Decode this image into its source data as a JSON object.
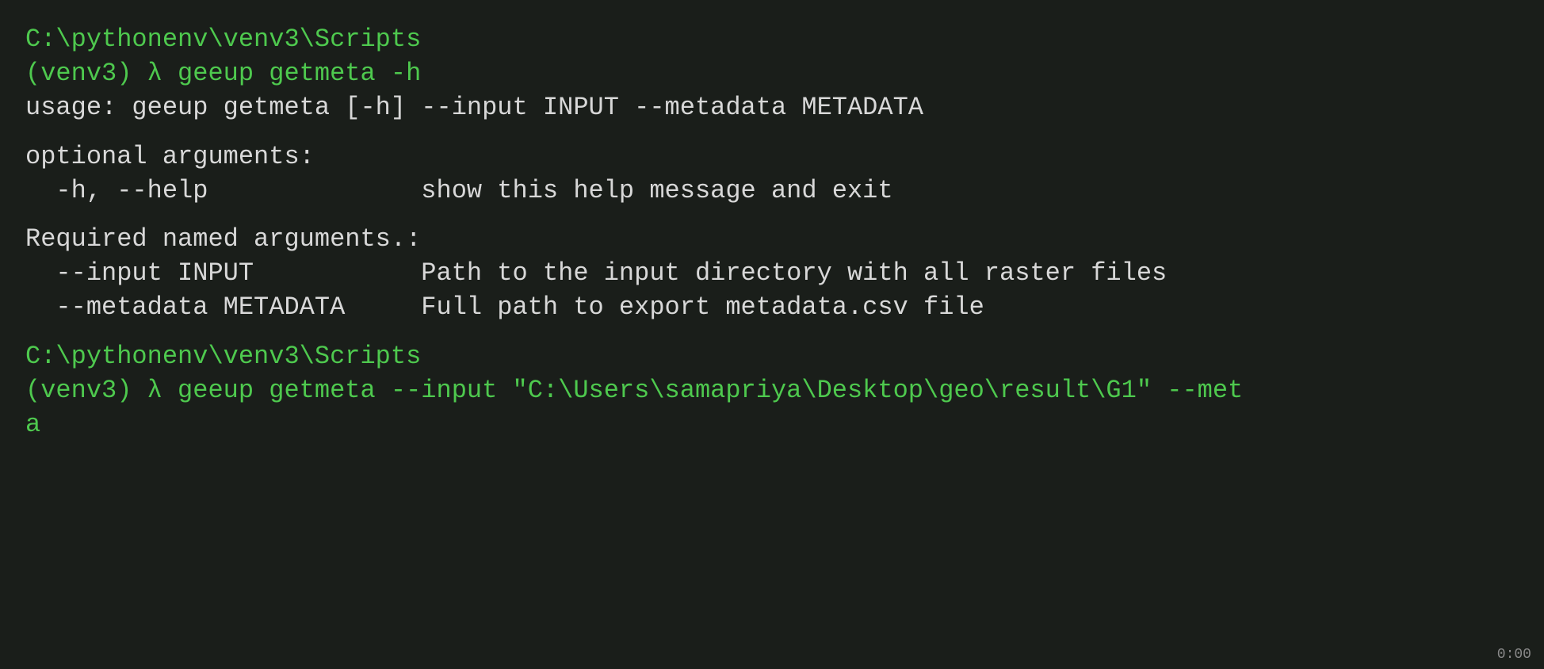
{
  "terminal": {
    "background": "#1a1e1a",
    "lines": [
      {
        "id": "path1",
        "text": "C:\\pythonenv\\venv3\\Scripts",
        "color": "green"
      },
      {
        "id": "prompt1",
        "text": "(venv3) λ geeup getmeta -h",
        "color": "green"
      },
      {
        "id": "usage",
        "text": "usage: geeup getmeta [-h] --input INPUT --metadata METADATA",
        "color": "white"
      },
      {
        "id": "spacer1",
        "text": "",
        "color": "white"
      },
      {
        "id": "optional",
        "text": "optional arguments:",
        "color": "white"
      },
      {
        "id": "help_flag",
        "text": "  -h, --help              show this help message and exit",
        "color": "white"
      },
      {
        "id": "spacer2",
        "text": "",
        "color": "white"
      },
      {
        "id": "required",
        "text": "Required named arguments.:",
        "color": "white"
      },
      {
        "id": "input_arg",
        "text": "  --input INPUT           Path to the input directory with all raster files",
        "color": "white"
      },
      {
        "id": "metadata_arg",
        "text": "  --metadata METADATA     Full path to export metadata.csv file",
        "color": "white"
      },
      {
        "id": "spacer3",
        "text": "",
        "color": "white"
      },
      {
        "id": "path2",
        "text": "C:\\pythonenv\\venv3\\Scripts",
        "color": "green"
      },
      {
        "id": "prompt2_line1",
        "text": "(venv3) λ geeup getmeta --input \"C:\\Users\\samapriya\\Desktop\\geo\\result\\G1\" --met",
        "color": "green"
      },
      {
        "id": "prompt2_line2",
        "text": "a",
        "color": "green"
      }
    ],
    "timestamp": "0:00"
  }
}
